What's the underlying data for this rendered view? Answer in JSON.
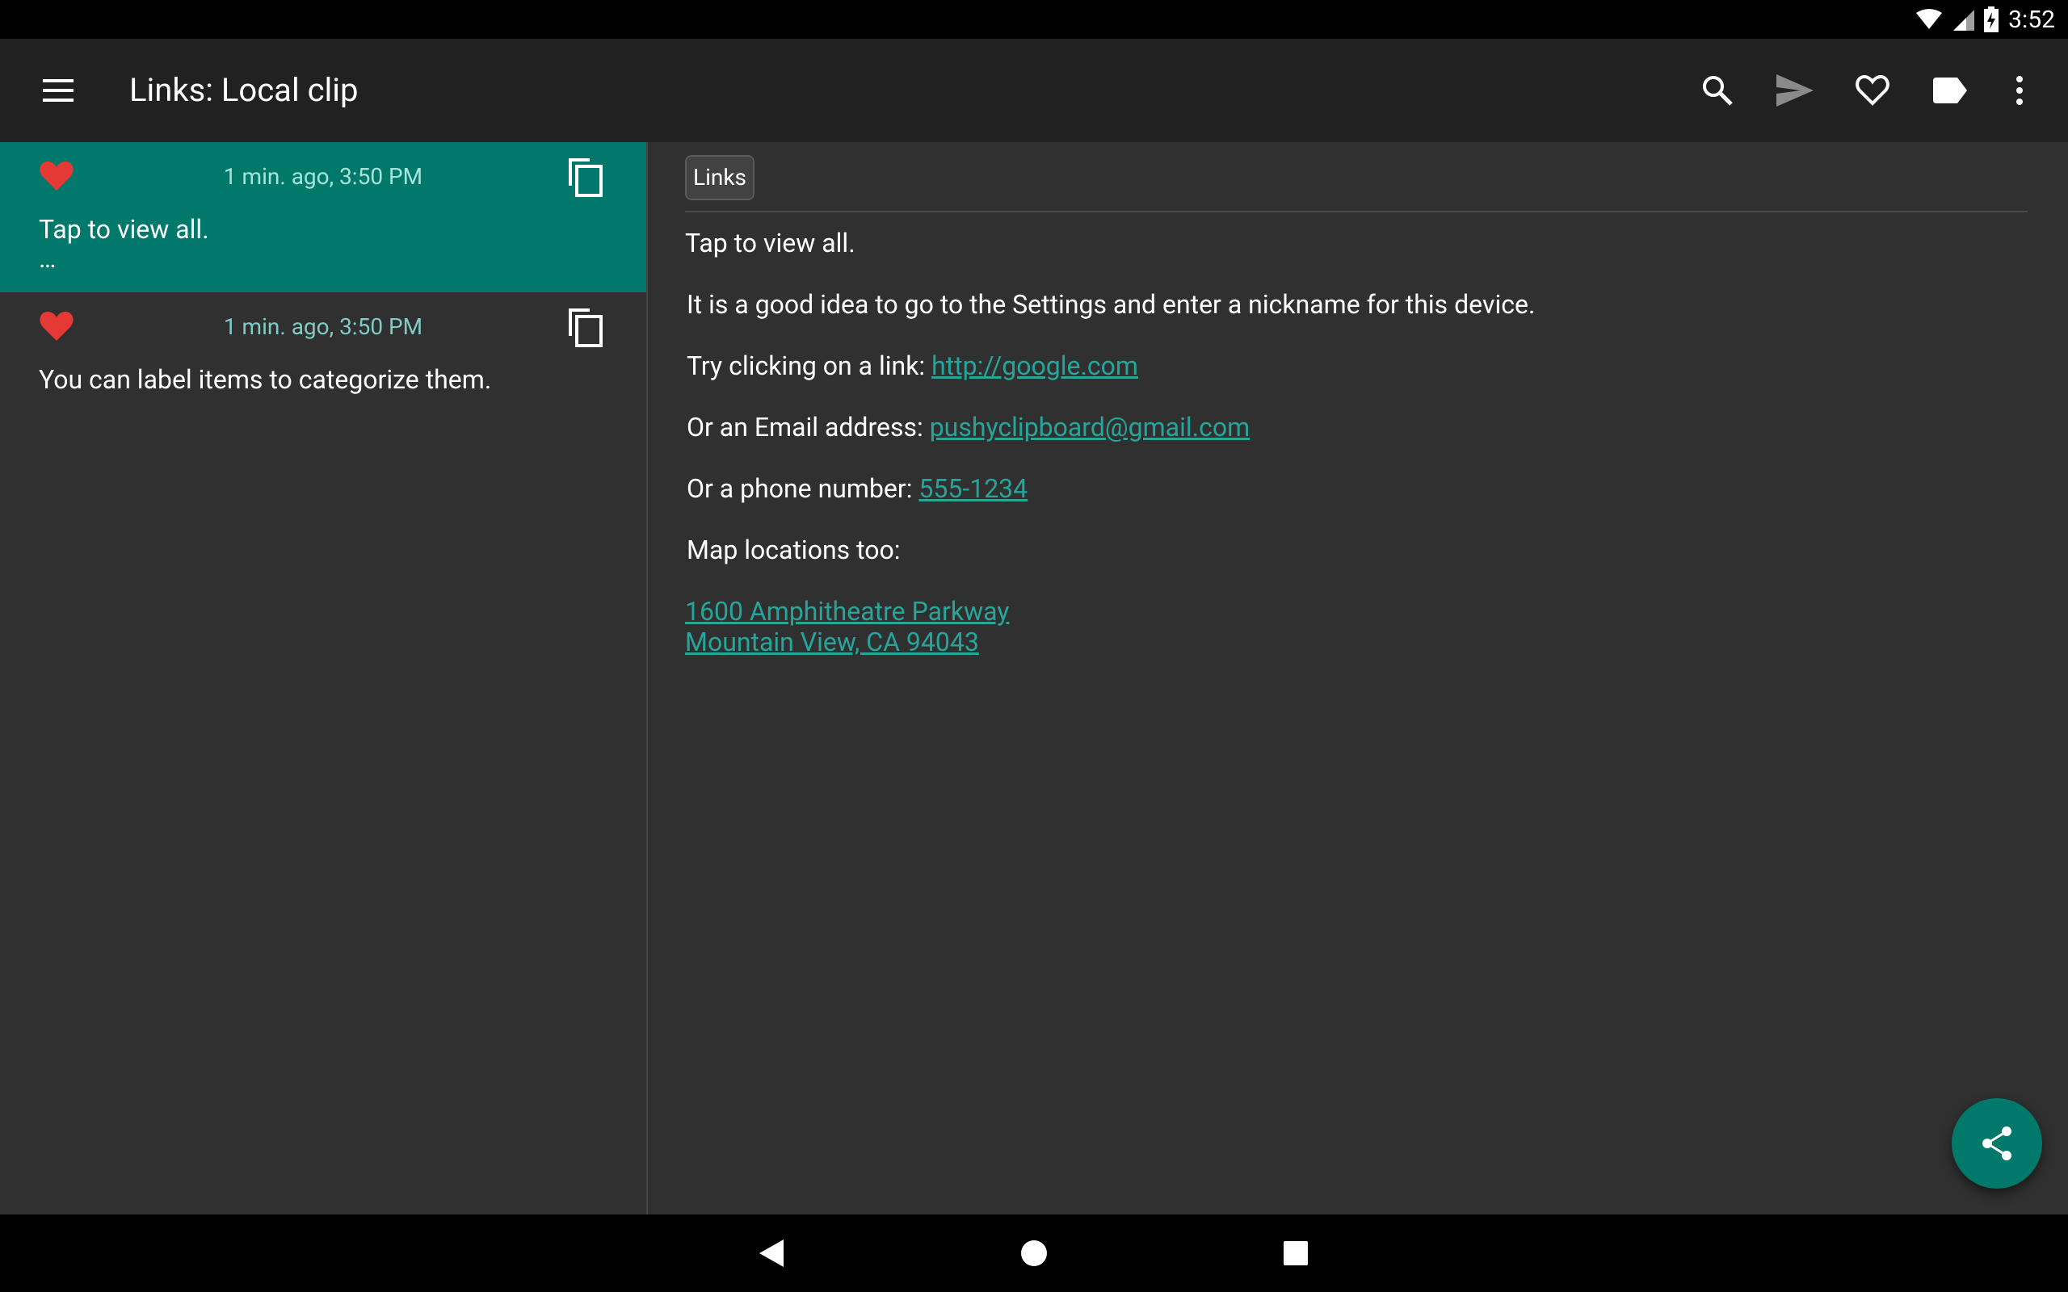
{
  "status_bar": {
    "time": "3:52"
  },
  "toolbar": {
    "title": "Links: Local clip",
    "icons": [
      "menu-icon",
      "search-icon",
      "send-icon",
      "heart-outline-icon",
      "label-icon",
      "more-vert-icon"
    ]
  },
  "clips": [
    {
      "time": "1 min. ago, 3:50 PM",
      "text": "Tap to view all.\n…",
      "favorite": true,
      "selected": true
    },
    {
      "time": "1 min. ago, 3:50 PM",
      "text": "You can label items to categorize them.",
      "favorite": true,
      "selected": false
    }
  ],
  "detail": {
    "label_chip": "Links",
    "line1": "Tap to view all.",
    "line2": "It is a good idea to go to the Settings and enter a nickname for this device.",
    "line3_prefix": "Try clicking on a link: ",
    "line3_link": "http://google.com",
    "line4_prefix": "Or an Email address: ",
    "line4_link": "pushyclipboard@gmail.com",
    "line5_prefix": "Or a phone number: ",
    "line5_link": "555-1234",
    "line6": "Map locations too:",
    "address_line1": "1600 Amphitheatre Parkway",
    "address_line2": "Mountain View, CA 94043"
  },
  "colors": {
    "accent": "#00796b",
    "link": "#26a69a",
    "heart": "#e53935",
    "background": "#303030",
    "toolbar": "#212121"
  }
}
